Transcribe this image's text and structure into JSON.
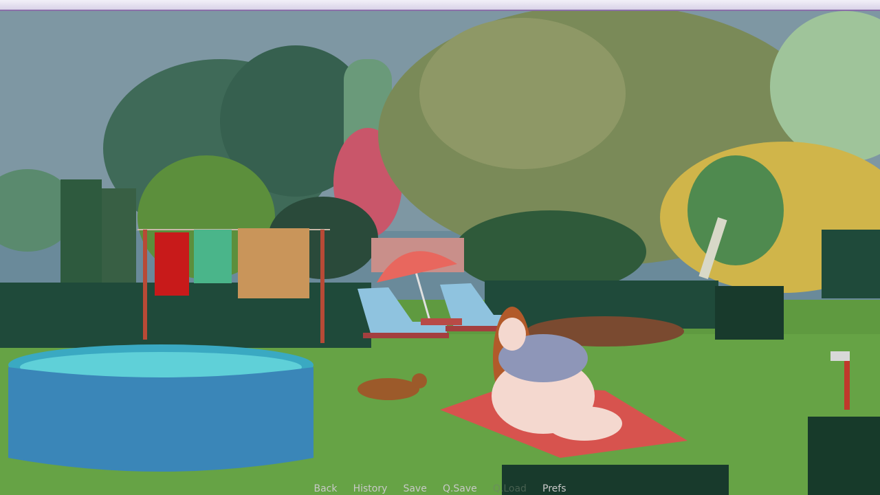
{
  "quick_menu": {
    "back": "Back",
    "history": "History",
    "save": "Save",
    "qsave": "Q.Save",
    "qload": "Q.Load",
    "prefs": "Prefs"
  },
  "colors": {
    "sky": "#7d97a4",
    "lawn": "#5e9a3f",
    "hedge": "#1f4a3a",
    "pool_water": "#3fb9c9",
    "pool_wall": "#3a86b8",
    "towel": "#d7534e",
    "umbrella": "#e8675e",
    "lounger": "#8fc3df",
    "skin": "#f4d8cf",
    "hair": "#b25a2a",
    "dog": "#9c5a2a"
  }
}
